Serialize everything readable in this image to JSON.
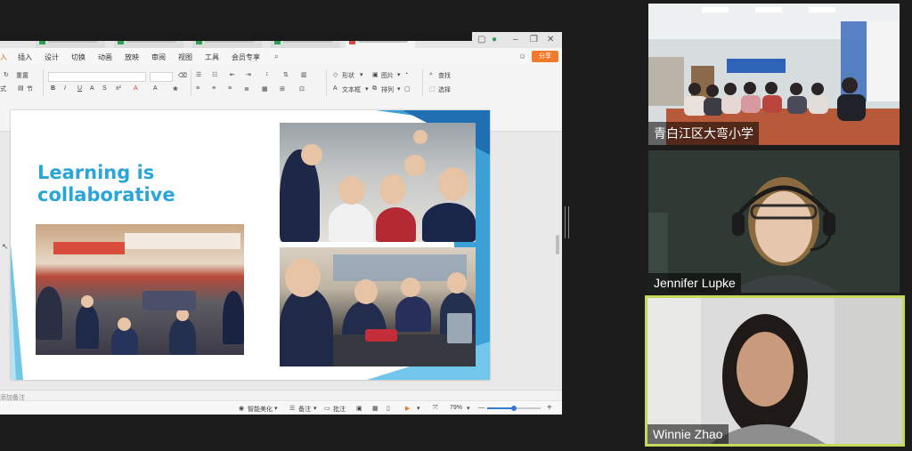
{
  "presentation": {
    "tabs": [
      "",
      "",
      "",
      "",
      ""
    ],
    "menu": [
      "入",
      "插入",
      "设计",
      "切换",
      "动画",
      "放映",
      "审阅",
      "视图",
      "工具",
      "会员专享"
    ],
    "share_label": "分享",
    "ribbon": {
      "redo_label": "重置",
      "section_label": "节",
      "format_label": "式",
      "shape_label": "形状",
      "picture_label": "图片",
      "textbox_label": "文本框",
      "arrange_label": "排列",
      "find_label": "查找",
      "select_label": "选择"
    },
    "slide": {
      "title": "Learning is collaborative"
    },
    "notes_hint": "添加备注",
    "status": {
      "beautify_label": "智能美化",
      "notes_label": "备注",
      "comment_label": "批注",
      "zoom": "79%",
      "zoom_fraction": 0.5,
      "minus": "—",
      "plus": "+"
    }
  },
  "participants": [
    {
      "name": "青白江区大弯小学",
      "active": false
    },
    {
      "name": "Jennifer Lupke",
      "active": false
    },
    {
      "name": "Winnie Zhao",
      "active": true
    }
  ],
  "colors": {
    "title_blue": "#2aa5d8",
    "accent_orange": "#f07a2a",
    "active_speaker_border": "#c7d95a",
    "background": "#1c1c1c"
  }
}
